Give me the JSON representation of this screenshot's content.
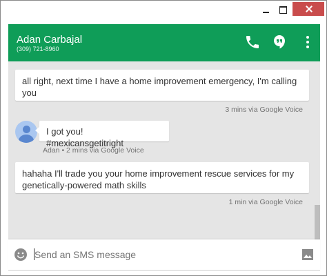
{
  "window": {
    "minimize_icon": "minimize-icon",
    "maximize_icon": "maximize-icon",
    "close_icon": "close-icon",
    "close_color": "#c94c4c"
  },
  "header": {
    "name": "Adan Carbajal",
    "phone": "(309) 721-8960",
    "bg_color": "#0f9d58",
    "icons": [
      "phone-icon",
      "hangouts-icon",
      "more-vert-icon"
    ]
  },
  "messages": [
    {
      "direction": "outgoing",
      "text": "all right, next time I have a home improvement emergency, I'm calling you",
      "meta": "3 mins via Google Voice"
    },
    {
      "direction": "incoming",
      "text": "I got you! #mexicansgetitright",
      "meta": "Adan • 2 mins via Google Voice"
    },
    {
      "direction": "outgoing",
      "text": "hahaha I'll trade you your home improvement rescue services for my genetically-powered math skills",
      "meta": "1 min via Google Voice"
    }
  ],
  "composer": {
    "placeholder": "Send an SMS message",
    "value": "",
    "emoji_icon": "smiley-icon",
    "attach_icon": "image-icon"
  }
}
